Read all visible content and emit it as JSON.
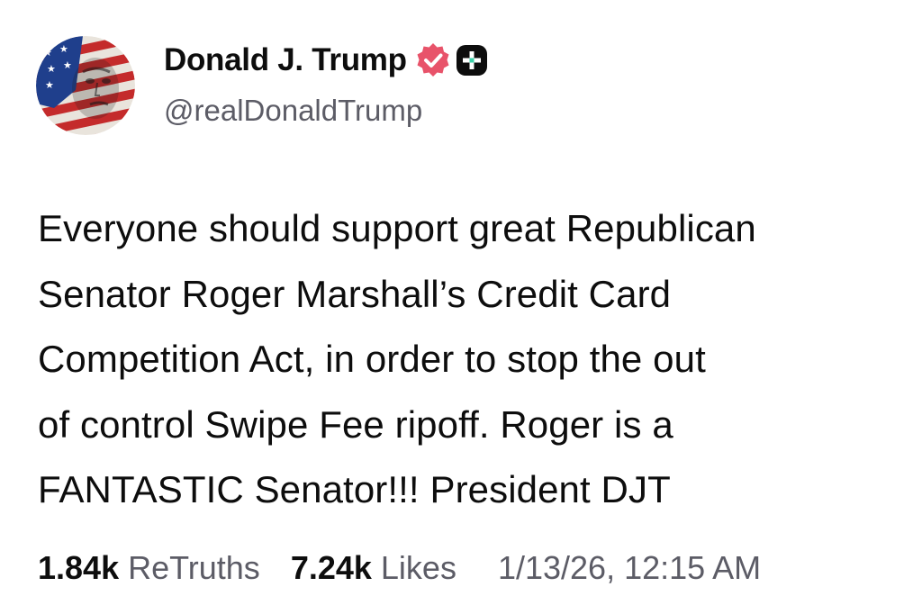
{
  "author": {
    "display_name": "Donald J. Trump",
    "handle": "@realDonaldTrump",
    "avatar_icon": "flag-face-avatar",
    "verified_icon": "verified-badge-icon",
    "verified_color": "#e8536a",
    "plus_icon": "plus-badge-icon"
  },
  "post": {
    "lines": [
      "Everyone should support great Republican",
      "Senator Roger Marshall’s Credit Card",
      "Competition Act, in order to stop the out",
      "of control Swipe Fee ripoff. Roger is a",
      "FANTASTIC Senator!!! President DJT"
    ]
  },
  "stats": {
    "retruths_count": "1.84k",
    "retruths_label": "ReTruths",
    "likes_count": "7.24k",
    "likes_label": "Likes",
    "timestamp": "1/13/26, 12:15 AM"
  },
  "colors": {
    "text": "#0d0d0d",
    "muted": "#5c5c66",
    "background": "#ffffff"
  }
}
